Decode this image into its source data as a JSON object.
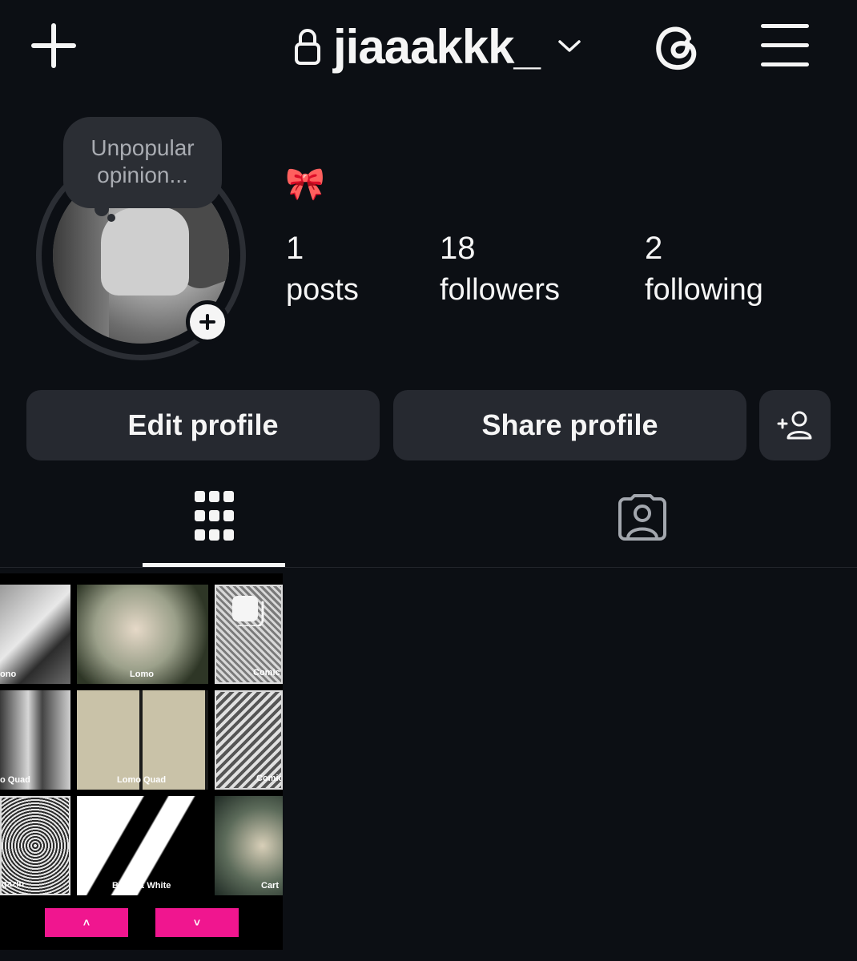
{
  "header": {
    "username": "jiaaakkk_",
    "icons": [
      "plus-icon",
      "lock-icon",
      "chevron-down-icon",
      "threads-icon",
      "menu-icon"
    ]
  },
  "profile": {
    "note": "Unpopular opinion...",
    "bio_emoji": "🎀",
    "stats": {
      "posts_count": "1",
      "posts_label": "posts",
      "followers_count": "18",
      "followers_label": "followers",
      "following_count": "2",
      "following_label": "following"
    }
  },
  "actions": {
    "edit_label": "Edit profile",
    "share_label": "Share profile",
    "add_person_icon": "add-person-icon"
  },
  "tabs": [
    {
      "icon": "grid-icon",
      "active": true
    },
    {
      "icon": "tagged-icon",
      "active": false
    }
  ],
  "post": {
    "cell_labels": [
      "ono",
      "Lomo",
      "Comic",
      "o Quad",
      "Lomo Quad",
      "Comic",
      "gazin",
      "Black & White",
      "Cart"
    ],
    "up_arrow": "˄",
    "down_arrow": "˅",
    "accent": "#f0168f"
  },
  "colors": {
    "background": "#0c0f14",
    "button": "#262930",
    "text": "#f5f5f5"
  }
}
